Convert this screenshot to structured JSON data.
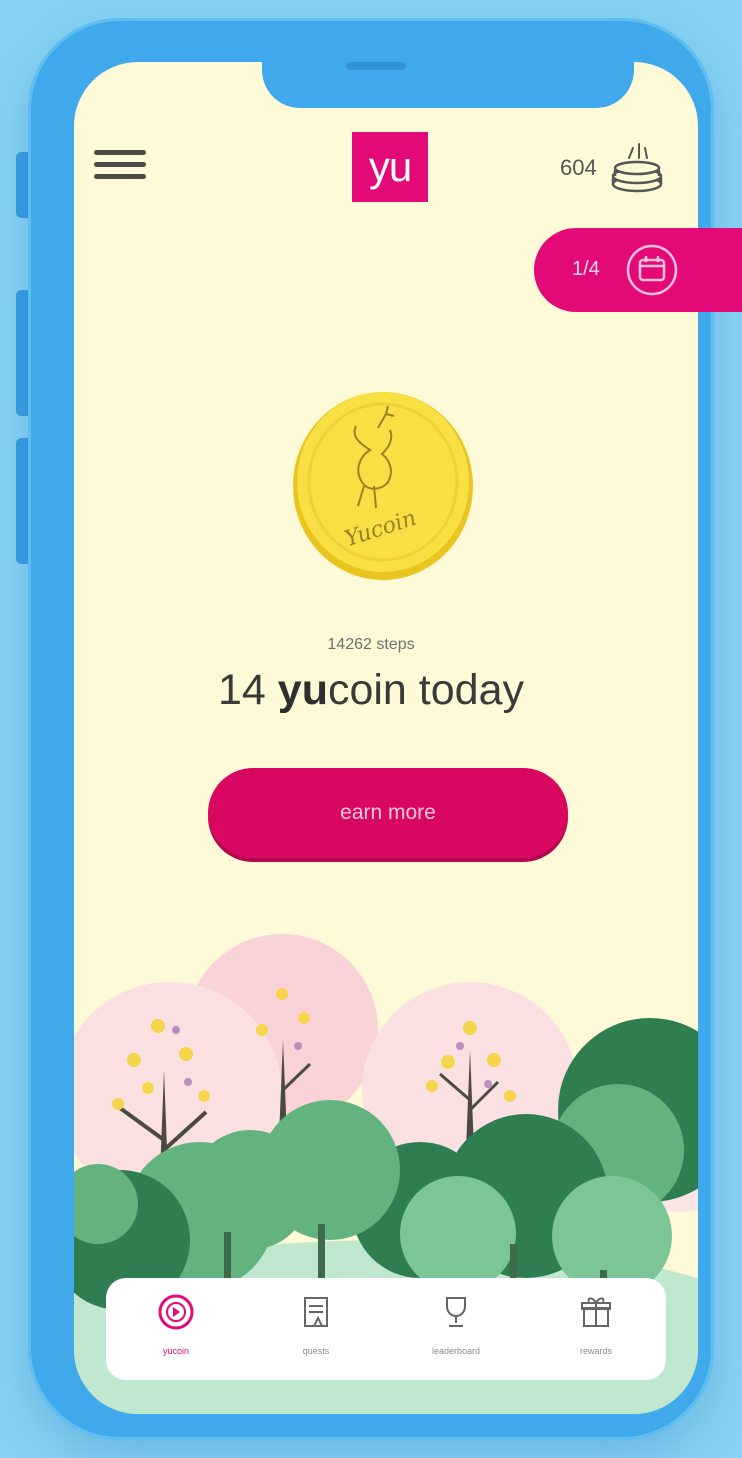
{
  "header": {
    "logo_text": "yu",
    "coin_balance": "604"
  },
  "quest_pill": {
    "progress_text": "1/4"
  },
  "coin": {
    "label": "Yucoin"
  },
  "stats": {
    "steps_text": "14262 steps",
    "coins_count": "14",
    "brand_part": "yu",
    "rest_text": "coin today"
  },
  "earn_button": {
    "label": "earn more"
  },
  "nav": {
    "items": [
      {
        "label": "yucoin",
        "icon": "coin-icon",
        "active": true
      },
      {
        "label": "quests",
        "icon": "quests-icon",
        "active": false
      },
      {
        "label": "leaderboard",
        "icon": "trophy-icon",
        "active": false
      },
      {
        "label": "rewards",
        "icon": "gift-icon",
        "active": false
      }
    ]
  },
  "colors": {
    "accent": "#e30a78",
    "screen_bg": "#fefad8",
    "frame": "#3fa9eb",
    "page_bg": "#86d2f4",
    "coin_gold": "#f6dc3a"
  }
}
